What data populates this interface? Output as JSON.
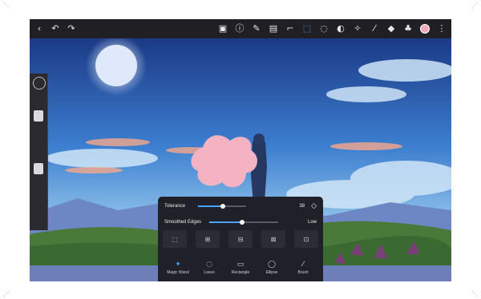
{
  "toolbar": {
    "left_icons": [
      "back-icon",
      "undo-icon",
      "redo-icon"
    ],
    "right_icons": [
      "save-icon",
      "info-icon",
      "wrench-icon",
      "layers-icon",
      "crop-icon",
      "selection-icon",
      "lasso-icon",
      "smudge-icon",
      "liquify-icon",
      "brush-icon",
      "eraser-icon",
      "fill-icon",
      "color-icon",
      "more-icon"
    ],
    "active_tool": "selection-icon",
    "brush_color": "#f2a8b6"
  },
  "selection_panel": {
    "tolerance_label": "Tolerance",
    "tolerance_value": "38",
    "smooth_edges_label": "Smoothed Edges",
    "smooth_edges_value": "Low",
    "tool_labels": [
      "Magic Wand",
      "Lasso",
      "Rectangle",
      "Ellipse",
      "Brush"
    ],
    "active_tool": "Magic Wand"
  },
  "scene": {
    "sky_top": "#1b3a86",
    "sky_mid": "#3d7fd0",
    "horizon": "#f6cfa6",
    "ground": "#4a7a3a",
    "water": "#6d7fb8",
    "moon": "#e9f0ff",
    "selection_color": "#f3b3c2"
  }
}
